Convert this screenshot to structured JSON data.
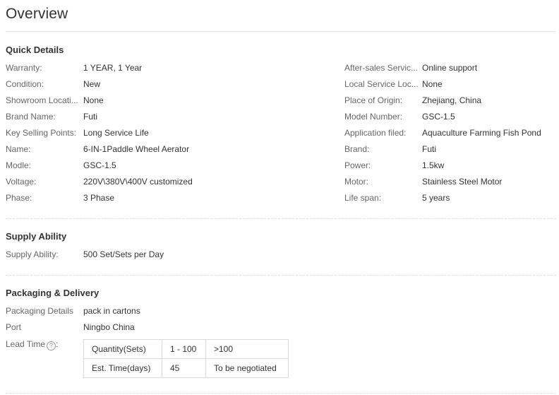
{
  "overview": {
    "title": "Overview"
  },
  "quick_details": {
    "title": "Quick Details",
    "left": [
      {
        "label": "Warranty:",
        "value": "1 YEAR, 1 Year"
      },
      {
        "label": "Condition:",
        "value": "New"
      },
      {
        "label": "Showroom Locati...",
        "value": "None"
      },
      {
        "label": "Brand Name:",
        "value": "Futi"
      },
      {
        "label": "Key Selling Points:",
        "value": "Long Service Life"
      },
      {
        "label": "Name:",
        "value": "6-IN-1Paddle Wheel Aerator"
      },
      {
        "label": "Modle:",
        "value": "GSC-1.5"
      },
      {
        "label": "Voltage:",
        "value": "220V\\380V\\400V customized"
      },
      {
        "label": "Phase:",
        "value": "3 Phase"
      }
    ],
    "right": [
      {
        "label": "After-sales Servic...",
        "value": "Online support"
      },
      {
        "label": "Local Service Loc...",
        "value": "None"
      },
      {
        "label": "Place of Origin:",
        "value": "Zhejiang, China"
      },
      {
        "label": "Model Number:",
        "value": "GSC-1.5"
      },
      {
        "label": "Application filed:",
        "value": "Aquaculture Farming Fish Pond"
      },
      {
        "label": "Brand:",
        "value": "Futi"
      },
      {
        "label": "Power:",
        "value": "1.5kw"
      },
      {
        "label": "Motor:",
        "value": "Stainless Steel Motor"
      },
      {
        "label": "Life span:",
        "value": "5 years"
      }
    ]
  },
  "supply_ability": {
    "title": "Supply Ability",
    "label": "Supply Ability:",
    "value": "500 Set/Sets per Day"
  },
  "packaging": {
    "title": "Packaging & Delivery",
    "details_label": "Packaging Details",
    "details_value": "pack in cartons",
    "port_label": "Port",
    "port_value": "Ningbo China",
    "lead_time_label": "Lead Time",
    "lead_time_icon": "?",
    "lead_table": [
      [
        "Quantity(Sets)",
        "1 - 100",
        ">100"
      ],
      [
        "Est. Time(days)",
        "45",
        "To be negotiated"
      ]
    ]
  }
}
